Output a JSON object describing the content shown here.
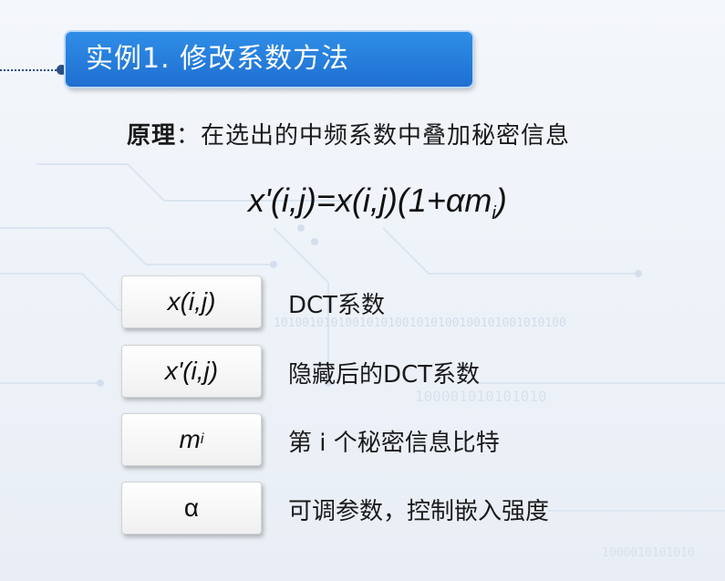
{
  "title": "实例1. 修改系数方法",
  "principle": {
    "label": "原理",
    "sep": "：",
    "text": "在选出的中频系数中叠加秘密信息"
  },
  "formula": {
    "lhs": "x'(i,j)=x(i,j)(1+αm",
    "sub": "i",
    "tail": ")"
  },
  "definitions": [
    {
      "term": "x(i,j)",
      "desc": "DCT系数"
    },
    {
      "term": "x'(i,j)",
      "desc": "隐藏后的DCT系数"
    },
    {
      "term": "m",
      "term_sub": "i",
      "desc": "第 i 个秘密信息比特"
    },
    {
      "term": "α",
      "desc": "可调参数，控制嵌入强度"
    }
  ],
  "background": {
    "binary_text_1": "10100101010010101001010100100101001010100",
    "binary_text_2": "100001010101010",
    "binary_text_3": "1000010101010"
  }
}
